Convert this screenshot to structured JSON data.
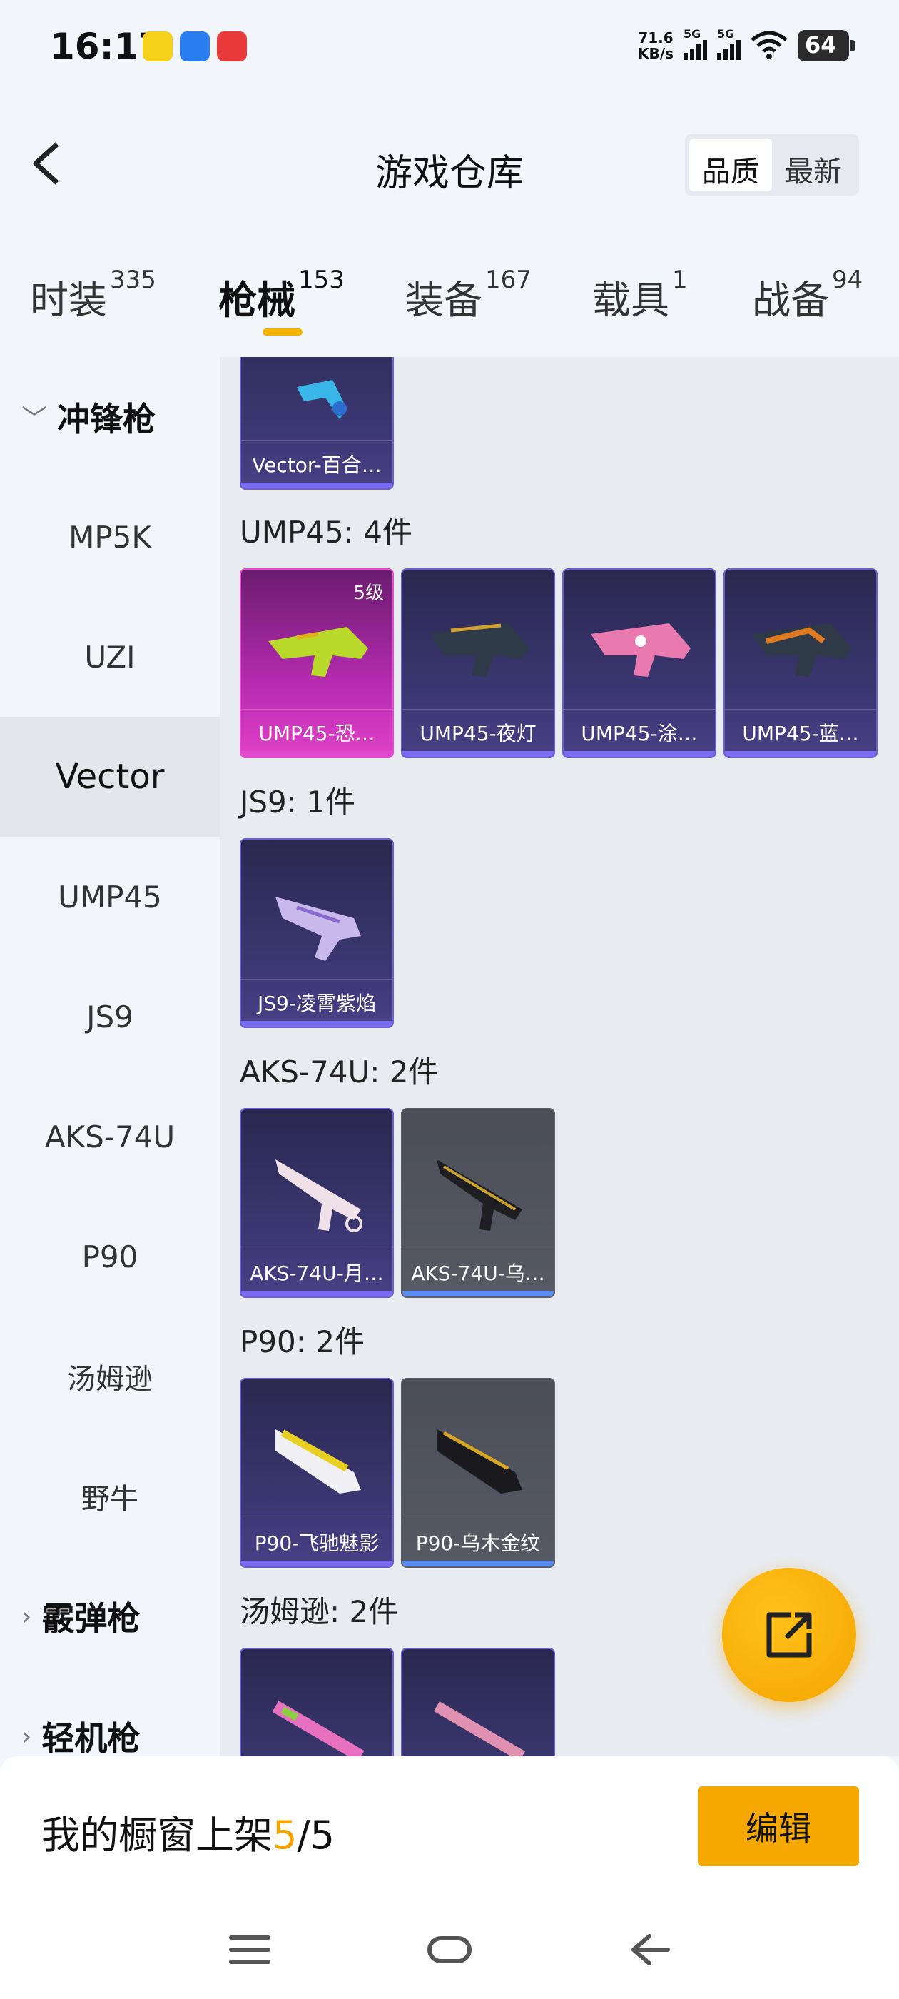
{
  "status_bar": {
    "time": "16:17",
    "net_speed_value": "71.6",
    "net_speed_unit": "KB/s",
    "sim1": "5G",
    "sim2": "5G",
    "battery": "64",
    "app_icons": [
      "app-icon-yellow",
      "app-icon-blue",
      "app-icon-red"
    ]
  },
  "header": {
    "title": "游戏仓库",
    "sort_options": [
      "品质",
      "最新"
    ],
    "sort_selected": "品质"
  },
  "tabs": [
    {
      "label": "时装",
      "count": "335"
    },
    {
      "label": "枪械",
      "count": "153",
      "active": true
    },
    {
      "label": "装备",
      "count": "167"
    },
    {
      "label": "载具",
      "count": "1"
    },
    {
      "label": "战备",
      "count": "94"
    }
  ],
  "sidebar": {
    "groups": [
      {
        "label": "冲锋枪",
        "expanded": true
      },
      {
        "label": "霰弹枪",
        "expanded": false
      },
      {
        "label": "轻机枪",
        "expanded": false
      }
    ],
    "items": [
      "MP5K",
      "UZI",
      "Vector",
      "UMP45",
      "JS9",
      "AKS-74U",
      "P90",
      "汤姆逊",
      "野牛"
    ],
    "selected": "Vector"
  },
  "content": {
    "sections": [
      {
        "label": "",
        "items": [
          {
            "name": "Vector-百合…",
            "quality": "purple"
          }
        ]
      },
      {
        "label": "UMP45: 4件",
        "items": [
          {
            "name": "UMP45-恐…",
            "quality": "pink",
            "level": "5级"
          },
          {
            "name": "UMP45-夜灯",
            "quality": "purple"
          },
          {
            "name": "UMP45-涂…",
            "quality": "purple"
          },
          {
            "name": "UMP45-蓝…",
            "quality": "purple"
          }
        ]
      },
      {
        "label": "JS9: 1件",
        "items": [
          {
            "name": "JS9-凌霄紫焰",
            "quality": "purple"
          }
        ]
      },
      {
        "label": "AKS-74U: 2件",
        "items": [
          {
            "name": "AKS-74U-月…",
            "quality": "purple"
          },
          {
            "name": "AKS-74U-乌…",
            "quality": "gray"
          }
        ]
      },
      {
        "label": "P90: 2件",
        "items": [
          {
            "name": "P90-飞驰魅影",
            "quality": "purple"
          },
          {
            "name": "P90-乌木金纹",
            "quality": "gray"
          }
        ]
      },
      {
        "label": "汤姆逊: 2件",
        "items": [
          {
            "name": "",
            "quality": "purple"
          },
          {
            "name": "",
            "quality": "purple"
          }
        ]
      }
    ]
  },
  "showcase": {
    "prefix": "我的橱窗上架",
    "current": "5",
    "separator": "/",
    "total": "5",
    "edit_label": "编辑"
  },
  "colors": {
    "accent": "#f5a800",
    "purple_quality": "#6b5fd0",
    "pink_quality": "#e24ad0"
  }
}
